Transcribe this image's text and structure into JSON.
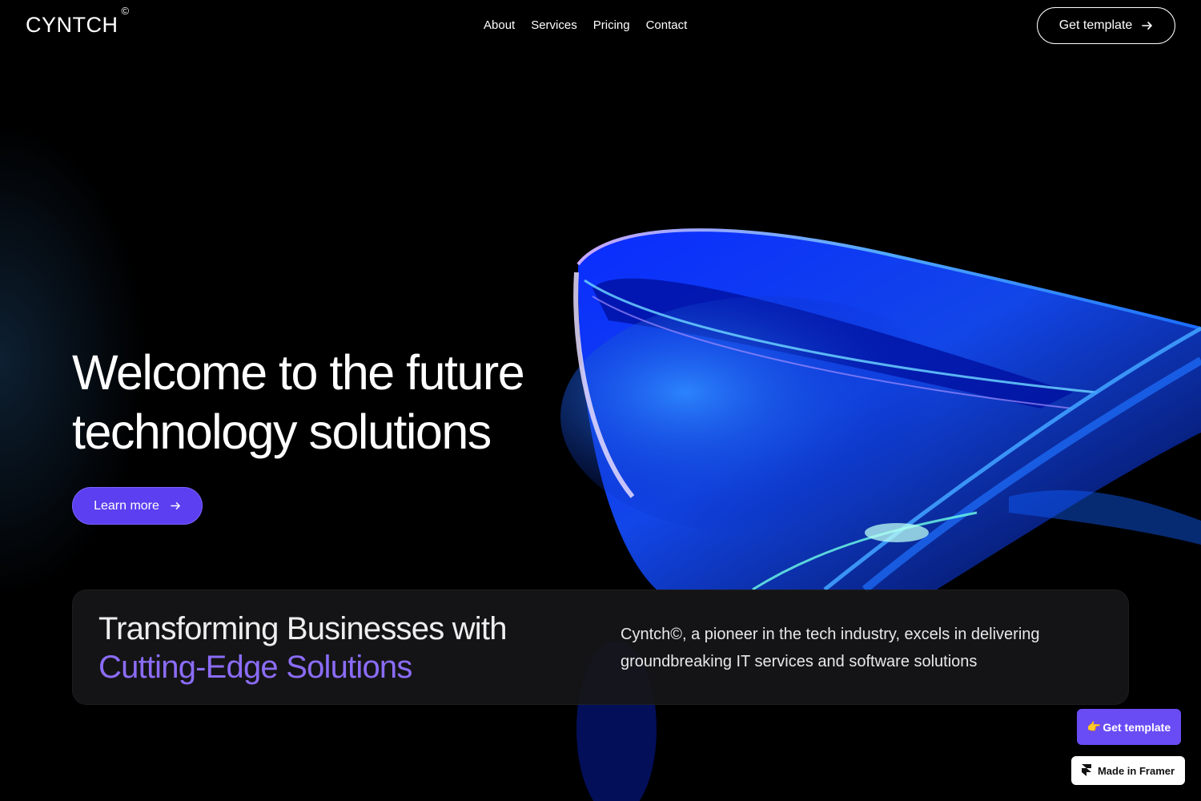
{
  "brand": {
    "name": "CYNTCH",
    "mark": "©"
  },
  "nav": {
    "items": [
      "About",
      "Services",
      "Pricing",
      "Contact"
    ]
  },
  "header": {
    "cta_label": "Get template"
  },
  "hero": {
    "title_line1": "Welcome to the future",
    "title_line2": "technology solutions",
    "button_label": "Learn more"
  },
  "info_card": {
    "heading_line1": "Transforming Businesses with",
    "heading_line2": "Cutting-Edge Solutions",
    "text": "Cyntch©, a pioneer in the tech industry, excels in delivering groundbreaking IT services and software solutions"
  },
  "floating": {
    "cta_emoji": "👉",
    "cta_label": "Get template",
    "framer_label": "Made in Framer"
  },
  "colors": {
    "accent": "#5b3ff0",
    "accent_text": "#8b6cf7",
    "background": "#000000"
  },
  "icons": {
    "arrow": "arrow-right-icon",
    "framer": "framer-logo-icon"
  }
}
